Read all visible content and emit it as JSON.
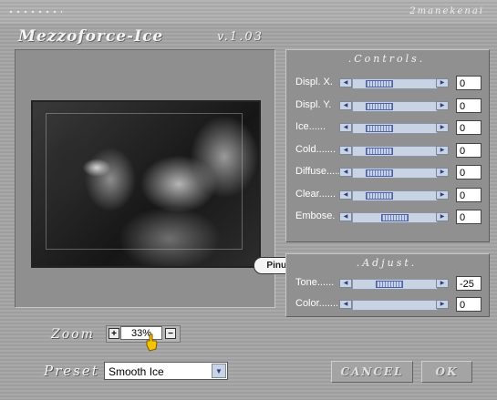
{
  "header": {
    "author": "2manekenai",
    "app_name": "Mezzoforce-Ice",
    "version": "v.1.03"
  },
  "preview": {
    "watermark": "Pinuccia"
  },
  "controls": {
    "title": ".Controls.",
    "rows": [
      {
        "label": "Displ. X.",
        "value": "0",
        "level": 0.22
      },
      {
        "label": "Displ. Y.",
        "value": "0",
        "level": 0.22
      },
      {
        "label": "Ice......",
        "value": "0",
        "level": 0.22
      },
      {
        "label": "Cold.......",
        "value": "0",
        "level": 0.22
      },
      {
        "label": "Diffuse.....",
        "value": "0",
        "level": 0.22
      },
      {
        "label": "Clear......",
        "value": "0",
        "level": 0.22
      },
      {
        "label": "Embose.",
        "value": "0",
        "level": 0.5
      }
    ]
  },
  "adjust": {
    "title": ".Adjust.",
    "rows": [
      {
        "label": "Tone......",
        "value": "-25",
        "level": 0.4
      },
      {
        "label": "Color.......",
        "value": "0",
        "level": 0.0
      }
    ]
  },
  "zoom": {
    "label": "Zoom",
    "plus": "+",
    "minus": "−",
    "value": "33%"
  },
  "preset": {
    "label": "Preset",
    "selected": "Smooth Ice"
  },
  "buttons": {
    "cancel": "CANCEL",
    "ok": "OK"
  },
  "colors": {
    "track": "#c8d3e4",
    "thumb": "#7082c2",
    "arrow": "#2f3c86"
  }
}
